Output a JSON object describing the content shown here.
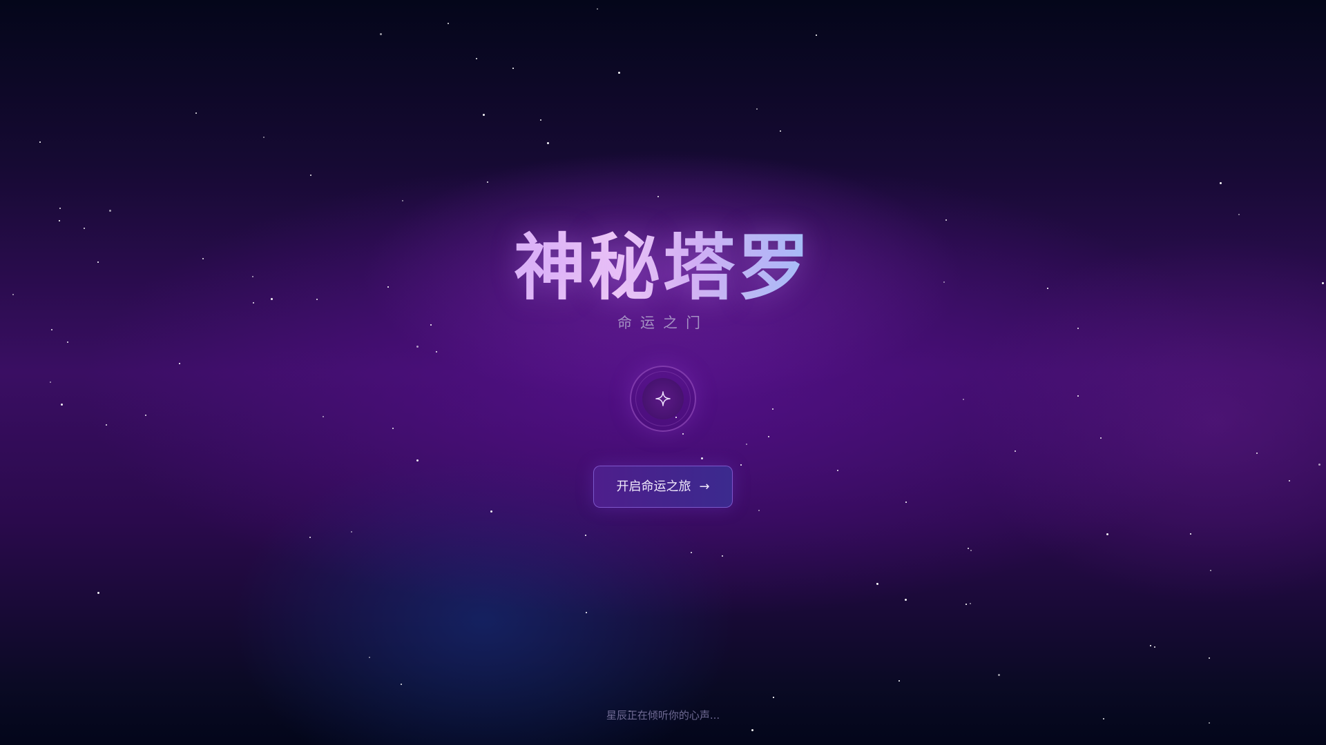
{
  "title": "神秘塔罗",
  "subtitle": "命运之门",
  "emblem": {
    "icon": "sparkle-icon"
  },
  "cta": {
    "label": "开启命运之旅",
    "arrow_icon": "arrow-right-icon",
    "arrow": "→"
  },
  "footer": {
    "text": "星辰正在倾听你的心声..."
  },
  "colors": {
    "background_top": "#04061a",
    "background_mid": "#3a0e63",
    "title_gradient_start": "#dcb6f6",
    "title_gradient_end": "#9ec4f6",
    "button": "#4e1e8c",
    "subtitle": "#a592c4"
  }
}
